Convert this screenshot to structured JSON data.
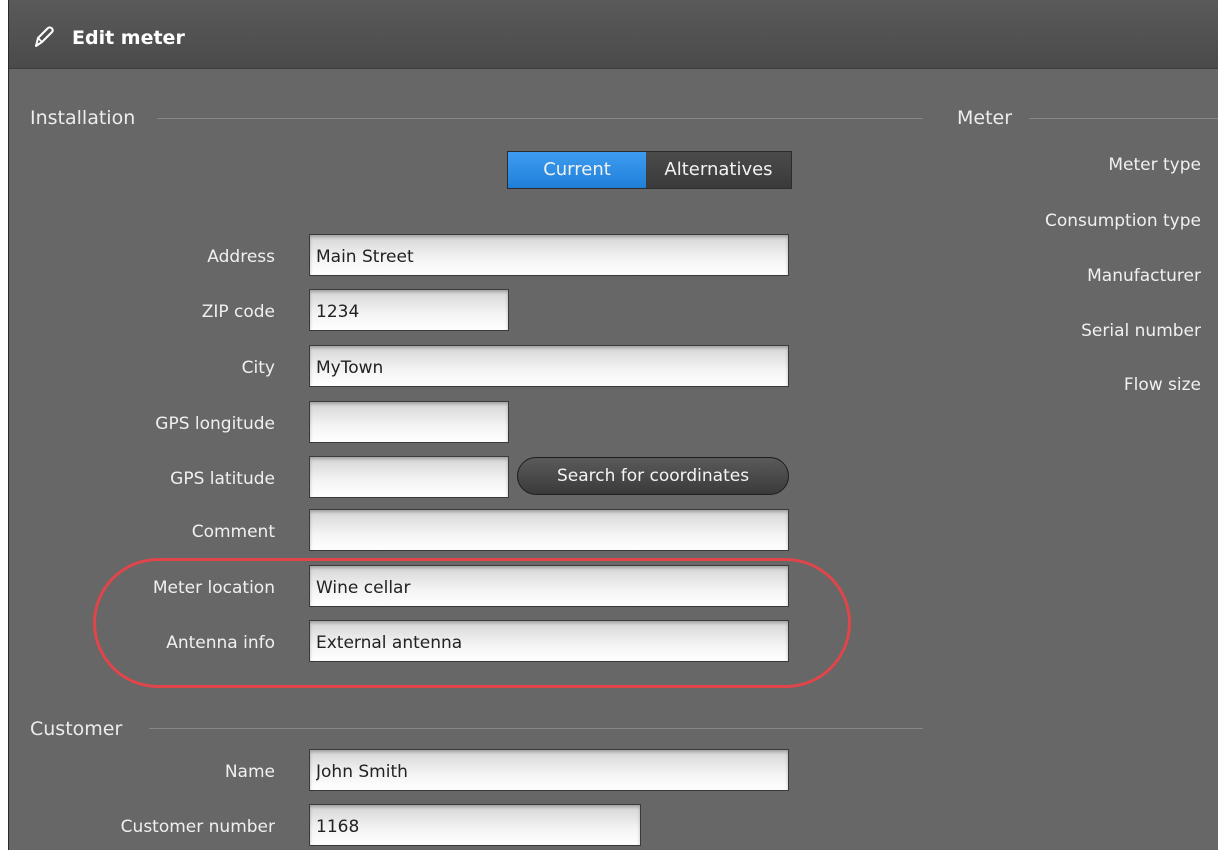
{
  "window": {
    "title": "Edit meter"
  },
  "installation": {
    "heading": "Installation",
    "toggle": {
      "current_label": "Current",
      "alternatives_label": "Alternatives",
      "selected": "Current"
    },
    "fields": {
      "address": {
        "label": "Address",
        "value": "Main Street"
      },
      "zip": {
        "label": "ZIP code",
        "value": "1234"
      },
      "city": {
        "label": "City",
        "value": "MyTown"
      },
      "gps_longitude": {
        "label": "GPS longitude",
        "value": ""
      },
      "gps_latitude": {
        "label": "GPS latitude",
        "value": ""
      },
      "comment": {
        "label": "Comment",
        "value": ""
      },
      "meter_location": {
        "label": "Meter location",
        "value": "Wine cellar"
      },
      "antenna_info": {
        "label": "Antenna info",
        "value": "External antenna"
      }
    },
    "search_coordinates_label": "Search for coordinates"
  },
  "customer": {
    "heading": "Customer",
    "fields": {
      "name": {
        "label": "Name",
        "value": "John Smith"
      },
      "customer_number": {
        "label": "Customer number",
        "value": "1168"
      }
    }
  },
  "meter": {
    "heading": "Meter",
    "labels": {
      "meter_type": "Meter type",
      "consumption_type": "Consumption type",
      "manufacturer": "Manufacturer",
      "serial_number": "Serial number",
      "flow_size": "Flow size"
    }
  },
  "colors": {
    "background": "#676767",
    "titlebar": "#4f4f4f",
    "accent_blue": "#2a8be2",
    "highlight_red": "#e0454a"
  },
  "icons": {
    "title": "pencil-icon"
  }
}
